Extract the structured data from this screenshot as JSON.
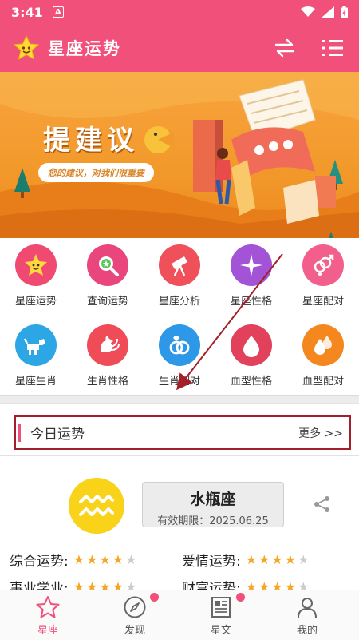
{
  "status_bar": {
    "time": "3:41",
    "notification_icon": "A"
  },
  "app_bar": {
    "title": "星座运势"
  },
  "banner": {
    "title": "提建议",
    "subtitle": "您的建议，对我们很重要"
  },
  "grid_items": [
    {
      "label": "星座运势",
      "color": "#f04a73",
      "icon": "star-face-icon"
    },
    {
      "label": "查询运势",
      "color": "#e8467c",
      "icon": "magnifier-icon"
    },
    {
      "label": "星座分析",
      "color": "#f0505a",
      "icon": "telescope-icon"
    },
    {
      "label": "星座性格",
      "color": "#a253d6",
      "icon": "sparkle-star-icon"
    },
    {
      "label": "星座配对",
      "color": "#f35f8c",
      "icon": "gender-symbol-icon"
    },
    {
      "label": "星座生肖",
      "color": "#2da6e6",
      "icon": "dog-icon"
    },
    {
      "label": "生肖性格",
      "color": "#ef4c58",
      "icon": "rooster-icon"
    },
    {
      "label": "生肖配对",
      "color": "#2e98e8",
      "icon": "rings-icon"
    },
    {
      "label": "血型性格",
      "color": "#e2415c",
      "icon": "blood-drop-icon"
    },
    {
      "label": "血型配对",
      "color": "#f5871f",
      "icon": "double-drop-icon"
    }
  ],
  "today": {
    "title": "今日运势",
    "more": "更多 >>"
  },
  "sign": {
    "name": "水瓶座",
    "validity": "有效期限：2025.06.25",
    "color": "#f9d21a"
  },
  "fortunes": [
    {
      "label": "综合运势:",
      "rating": 4
    },
    {
      "label": "爱情运势:",
      "rating": 4
    },
    {
      "label": "事业学业:",
      "rating": 4
    },
    {
      "label": "财富运势:",
      "rating": 4
    }
  ],
  "tabs": [
    {
      "label": "星座",
      "active": true,
      "badge": false
    },
    {
      "label": "发现",
      "active": false,
      "badge": true
    },
    {
      "label": "星文",
      "active": false,
      "badge": true
    },
    {
      "label": "我的",
      "active": false,
      "badge": false
    }
  ],
  "colors": {
    "brand": "#f0507a",
    "star_on": "#f5a623",
    "star_off": "#cccccc",
    "highlight": "#a31f2a"
  }
}
